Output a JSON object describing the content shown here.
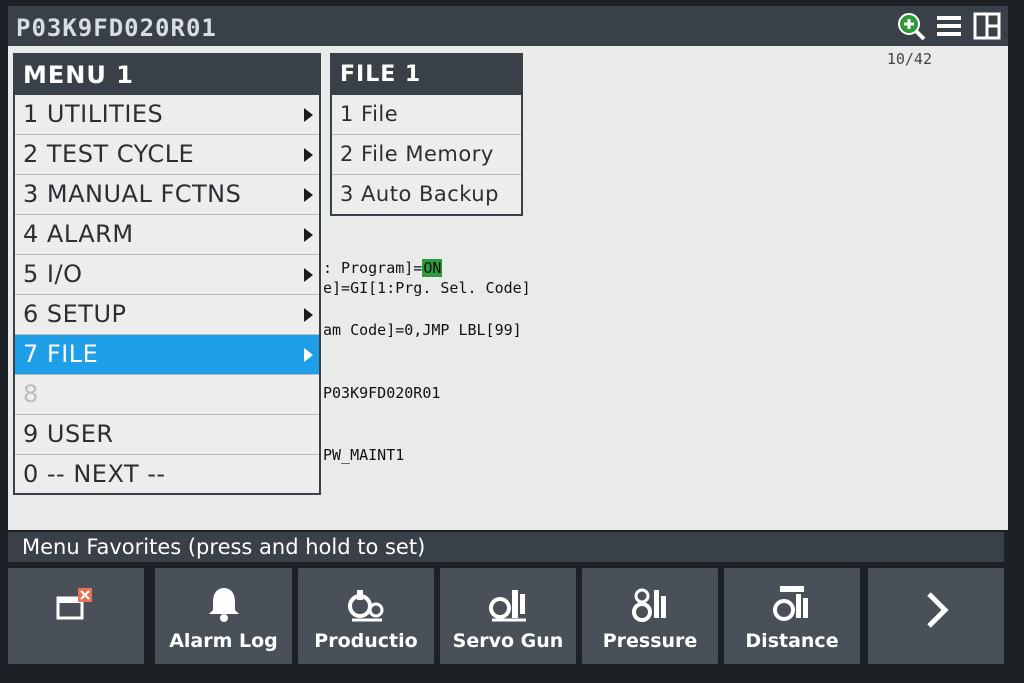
{
  "topbar": {
    "title": "P03K9FD020R01",
    "icons": [
      "zoom-in-icon",
      "hamburger-menu-icon",
      "window-layout-icon"
    ]
  },
  "content": {
    "position": "10/42",
    "lines": [
      {
        "text": ": Program]=",
        "highlight": "ON"
      },
      {
        "text": "e]=GI[1:Prg. Sel. Code]"
      },
      {
        "text": "am Code]=0,JMP LBL[99]"
      },
      {
        "text": "P03K9FD020R01"
      },
      {
        "text": "PW_MAINT1"
      }
    ]
  },
  "menu": {
    "title": "MENU  1",
    "items": [
      {
        "label": "1 UTILITIES",
        "submenu": true
      },
      {
        "label": "2 TEST CYCLE",
        "submenu": true
      },
      {
        "label": "3 MANUAL FCTNS",
        "submenu": true
      },
      {
        "label": "4 ALARM",
        "submenu": true
      },
      {
        "label": "5 I/O",
        "submenu": true
      },
      {
        "label": "6 SETUP",
        "submenu": true
      },
      {
        "label": "7 FILE",
        "submenu": true,
        "selected": true
      },
      {
        "label": "8",
        "disabled": true
      },
      {
        "label": "9 USER"
      },
      {
        "label": "0 -- NEXT --"
      }
    ]
  },
  "submenu": {
    "title": "FILE  1",
    "items": [
      {
        "label": "1 File"
      },
      {
        "label": "2 File Memory"
      },
      {
        "label": "3 Auto Backup"
      }
    ]
  },
  "favorites": {
    "label": "Menu Favorites (press and hold to set)"
  },
  "fkeys": [
    {
      "label": "",
      "icon": "window-close-icon"
    },
    {
      "label": "Alarm Log",
      "icon": "bell-icon"
    },
    {
      "label": "Productio",
      "icon": "production-icon"
    },
    {
      "label": "Servo Gun",
      "icon": "servo-gun-icon"
    },
    {
      "label": "Pressure",
      "icon": "pressure-icon"
    },
    {
      "label": "Distance",
      "icon": "distance-icon"
    },
    {
      "label": "",
      "icon": "chevron-right-icon"
    }
  ],
  "colors": {
    "accent": "#1e9fe8",
    "bar": "#3a4048",
    "on_highlight": "#2f9a3a"
  }
}
